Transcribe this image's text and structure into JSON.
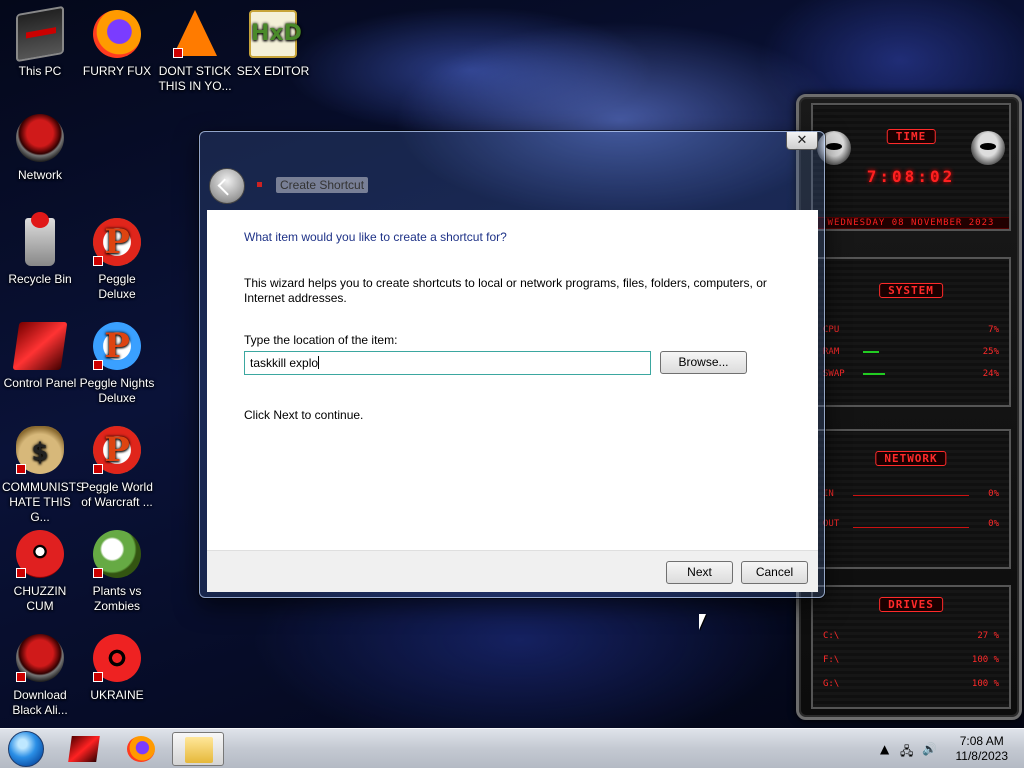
{
  "desktop": {
    "icons": [
      {
        "label": "This PC",
        "icon": "computer-icon"
      },
      {
        "label": "FURRY FUX",
        "icon": "firefox-icon"
      },
      {
        "label": "DONT STICK THIS IN YO...",
        "icon": "vlc-cone-icon"
      },
      {
        "label": "SEX EDITOR",
        "icon": "hxd-icon"
      },
      {
        "label": "Network",
        "icon": "alien-network-icon"
      },
      {
        "label": "Recycle Bin",
        "icon": "recycle-bin-icon"
      },
      {
        "label": "Peggle Deluxe",
        "icon": "peggle-icon"
      },
      {
        "label": "Control Panel",
        "icon": "control-panel-icon"
      },
      {
        "label": "Peggle Nights Deluxe",
        "icon": "peggle-nights-icon"
      },
      {
        "label": "COMMUNISTS HATE THIS G...",
        "icon": "money-bag-icon"
      },
      {
        "label": "Peggle World of Warcraft ...",
        "icon": "peggle-wow-icon"
      },
      {
        "label": "CHUZZIN CUM",
        "icon": "chuzzle-icon"
      },
      {
        "label": "Plants vs Zombies",
        "icon": "plants-vs-zombies-icon"
      },
      {
        "label": "Download Black Ali...",
        "icon": "alien-download-icon"
      },
      {
        "label": "UKRAINE",
        "icon": "radiation-icon"
      }
    ]
  },
  "widget": {
    "time_title": "TIME",
    "time": "7:08:02",
    "date": "WEDNESDAY 08 NOVEMBER 2023",
    "system_title": "SYSTEM",
    "system_rows": [
      {
        "key": "CPU",
        "value": "7%"
      },
      {
        "key": "RAM",
        "value": "25%"
      },
      {
        "key": "SWAP",
        "value": "24%"
      }
    ],
    "network_title": "NETWORK",
    "network_rows": [
      {
        "key": "IN",
        "value": "0%"
      },
      {
        "key": "OUT",
        "value": "0%"
      }
    ],
    "drives_title": "DRIVES",
    "drive_rows": [
      {
        "key": "C:\\",
        "value": "27 %"
      },
      {
        "key": "F:\\",
        "value": "100 %"
      },
      {
        "key": "G:\\",
        "value": "100 %"
      }
    ]
  },
  "dialog": {
    "title": "Create Shortcut",
    "close_label": "✕",
    "heading": "What item would you like to create a shortcut for?",
    "description": "This wizard helps you to create shortcuts to local or network programs, files, folders, computers, or Internet addresses.",
    "location_label": "Type the location of the item:",
    "location_value": "taskkill explo",
    "browse_label": "Browse...",
    "continue_text": "Click Next to continue.",
    "next_label": "Next",
    "cancel_label": "Cancel"
  },
  "taskbar": {
    "apps": [
      {
        "name": "alien-app",
        "icon": "alien-app-icon"
      },
      {
        "name": "firefox",
        "icon": "firefox-icon"
      },
      {
        "name": "file-explorer",
        "icon": "folder-icon"
      }
    ],
    "time": "7:08 AM",
    "date": "11/8/2023"
  }
}
